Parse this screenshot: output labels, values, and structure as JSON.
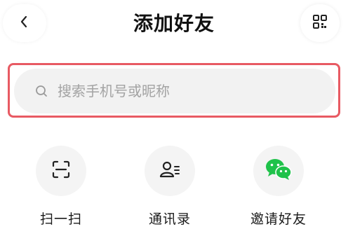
{
  "header": {
    "title": "添加好友",
    "back_icon": "chevron-left-icon",
    "qr_icon": "qr-code-icon"
  },
  "search": {
    "placeholder": "搜索手机号或昵称",
    "highlight_color": "#e85a63"
  },
  "actions": [
    {
      "label": "扫一扫",
      "icon": "scan-icon"
    },
    {
      "label": "通讯录",
      "icon": "contacts-icon"
    },
    {
      "label": "邀请好友",
      "icon": "wechat-icon",
      "icon_color": "#1fc24a"
    }
  ]
}
